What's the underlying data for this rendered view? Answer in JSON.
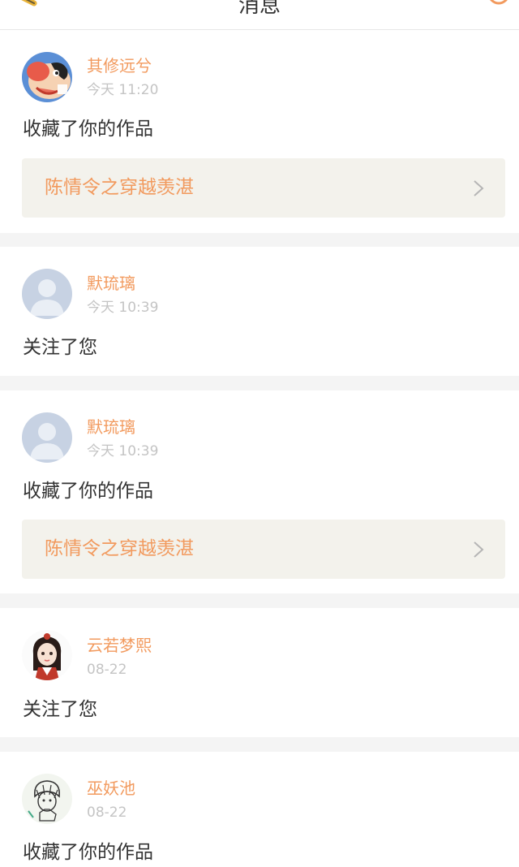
{
  "header": {
    "title": "消息",
    "left_icon": "edit-icon",
    "right_icon": "search-icon"
  },
  "colors": {
    "accent": "#f29a5e",
    "work_bg": "#f3f2ec",
    "page_bg": "#f4f4f4"
  },
  "messages": [
    {
      "username": "其修远兮",
      "time": "今天 11:20",
      "action": "收藏了你的作品",
      "work_title": "陈情令之穿越羡湛",
      "avatar": "cartoon-avatar"
    },
    {
      "username": "默琉璃",
      "time": "今天 10:39",
      "action": "关注了您",
      "avatar": "default-avatar"
    },
    {
      "username": "默琉璃",
      "time": "今天 10:39",
      "action": "收藏了你的作品",
      "work_title": "陈情令之穿越羡湛",
      "avatar": "default-avatar"
    },
    {
      "username": "云若梦熙",
      "time": "08-22",
      "action": "关注了您",
      "avatar": "anime-girl-avatar"
    },
    {
      "username": "巫妖池",
      "time": "08-22",
      "action": "收藏了你的作品",
      "avatar": "sketch-boy-avatar"
    }
  ]
}
